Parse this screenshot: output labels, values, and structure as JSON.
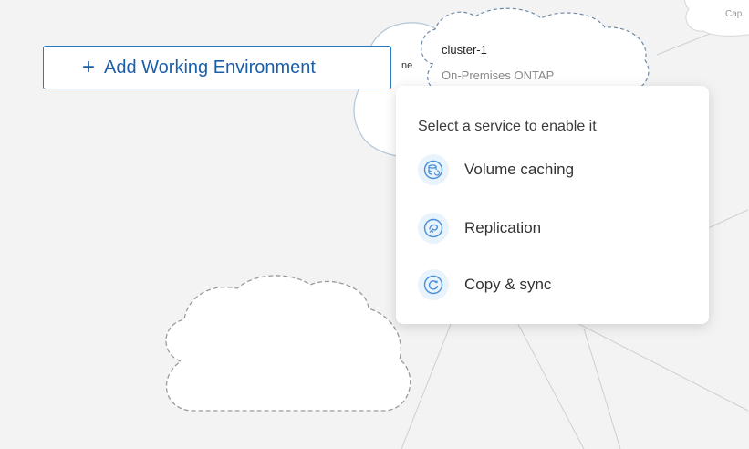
{
  "toolbar": {
    "add_working_environment_label": "Add Working Environment",
    "plus_glyph": "+"
  },
  "canvas": {
    "peek_label": "ne",
    "cap_label": "Cap",
    "working_environment": {
      "name": "cluster-1",
      "type": "On-Premises ONTAP"
    }
  },
  "service_popup": {
    "title": "Select a service to enable it",
    "services": [
      {
        "label": "Volume caching",
        "icon": "volume-caching-icon"
      },
      {
        "label": "Replication",
        "icon": "replication-icon"
      },
      {
        "label": "Copy & sync",
        "icon": "copy-sync-icon"
      }
    ]
  },
  "colors": {
    "accent": "#2a78c2",
    "background": "#f3f3f4",
    "icon_bg": "#e9f3fc"
  }
}
